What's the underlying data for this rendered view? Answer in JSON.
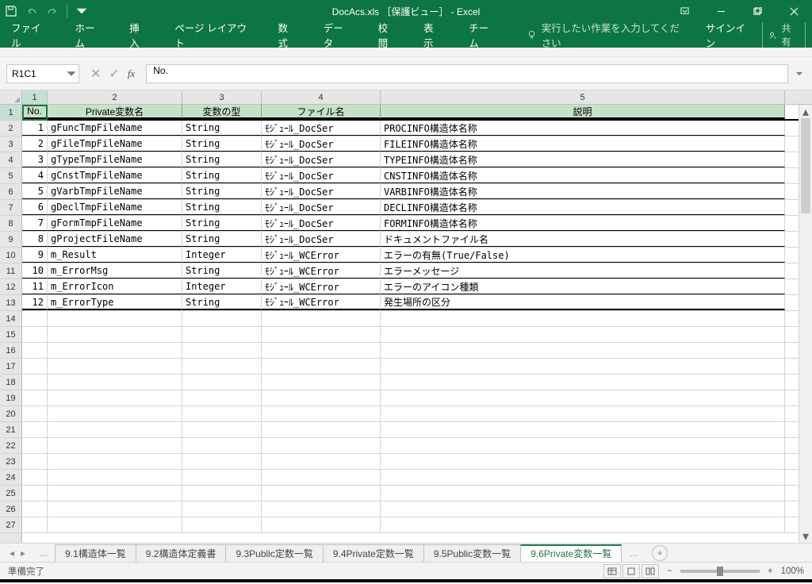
{
  "title": "DocAcs.xls ［保護ビュー］ - Excel",
  "ribbon": {
    "tabs": [
      "ファイル",
      "ホーム",
      "挿入",
      "ページ レイアウト",
      "数式",
      "データ",
      "校閲",
      "表示",
      "チーム"
    ],
    "tellme": "実行したい作業を入力してください",
    "signin": "サインイン",
    "share": "共有"
  },
  "fx": {
    "namebox": "R1C1",
    "formula": "No."
  },
  "columns": [
    {
      "num": "1",
      "label": "No."
    },
    {
      "num": "2",
      "label": "Private変数名"
    },
    {
      "num": "3",
      "label": "変数の型"
    },
    {
      "num": "4",
      "label": "ファイル名"
    },
    {
      "num": "5",
      "label": "説明"
    }
  ],
  "rows": [
    {
      "no": "1",
      "name": "gFuncTmpFileName",
      "type": "String",
      "file": "ﾓｼﾞｭｰﾙ_DocSer",
      "desc": "PROCINFO構造体名称"
    },
    {
      "no": "2",
      "name": "gFileTmpFileName",
      "type": "String",
      "file": "ﾓｼﾞｭｰﾙ_DocSer",
      "desc": "FILEINFO構造体名称"
    },
    {
      "no": "3",
      "name": "gTypeTmpFileName",
      "type": "String",
      "file": "ﾓｼﾞｭｰﾙ_DocSer",
      "desc": "TYPEINFO構造体名称"
    },
    {
      "no": "4",
      "name": "gCnstTmpFileName",
      "type": "String",
      "file": "ﾓｼﾞｭｰﾙ_DocSer",
      "desc": "CNSTINFO構造体名称"
    },
    {
      "no": "5",
      "name": "gVarbTmpFileName",
      "type": "String",
      "file": "ﾓｼﾞｭｰﾙ_DocSer",
      "desc": "VARBINFO構造体名称"
    },
    {
      "no": "6",
      "name": "gDeclTmpFileName",
      "type": "String",
      "file": "ﾓｼﾞｭｰﾙ_DocSer",
      "desc": "DECLINFO構造体名称"
    },
    {
      "no": "7",
      "name": "gFormTmpFileName",
      "type": "String",
      "file": "ﾓｼﾞｭｰﾙ_DocSer",
      "desc": "FORMINFO構造体名称"
    },
    {
      "no": "8",
      "name": "gProjectFileName",
      "type": "String",
      "file": "ﾓｼﾞｭｰﾙ_DocSer",
      "desc": "ドキュメントファイル名"
    },
    {
      "no": "9",
      "name": "m_Result",
      "type": "Integer",
      "file": "ﾓｼﾞｭｰﾙ_WCError",
      "desc": "エラーの有無(True/False)"
    },
    {
      "no": "10",
      "name": "m_ErrorMsg",
      "type": "String",
      "file": "ﾓｼﾞｭｰﾙ_WCError",
      "desc": "エラーメッセージ"
    },
    {
      "no": "11",
      "name": "m_ErrorIcon",
      "type": "Integer",
      "file": "ﾓｼﾞｭｰﾙ_WCError",
      "desc": "エラーのアイコン種類"
    },
    {
      "no": "12",
      "name": "m_ErrorType",
      "type": "String",
      "file": "ﾓｼﾞｭｰﾙ_WCError",
      "desc": "発生場所の区分"
    }
  ],
  "blank_rows": 14,
  "sheets": {
    "tabs": [
      "9.1構造体一覧",
      "9.2構造体定義書",
      "9.3Public定数一覧",
      "9.4Private定数一覧",
      "9.5Public変数一覧",
      "9.6Private変数一覧"
    ],
    "active": 5,
    "ellipsis": "...",
    "ready": "準備完了"
  },
  "zoom": {
    "pct": "100%",
    "minus": "−",
    "plus": "+"
  }
}
